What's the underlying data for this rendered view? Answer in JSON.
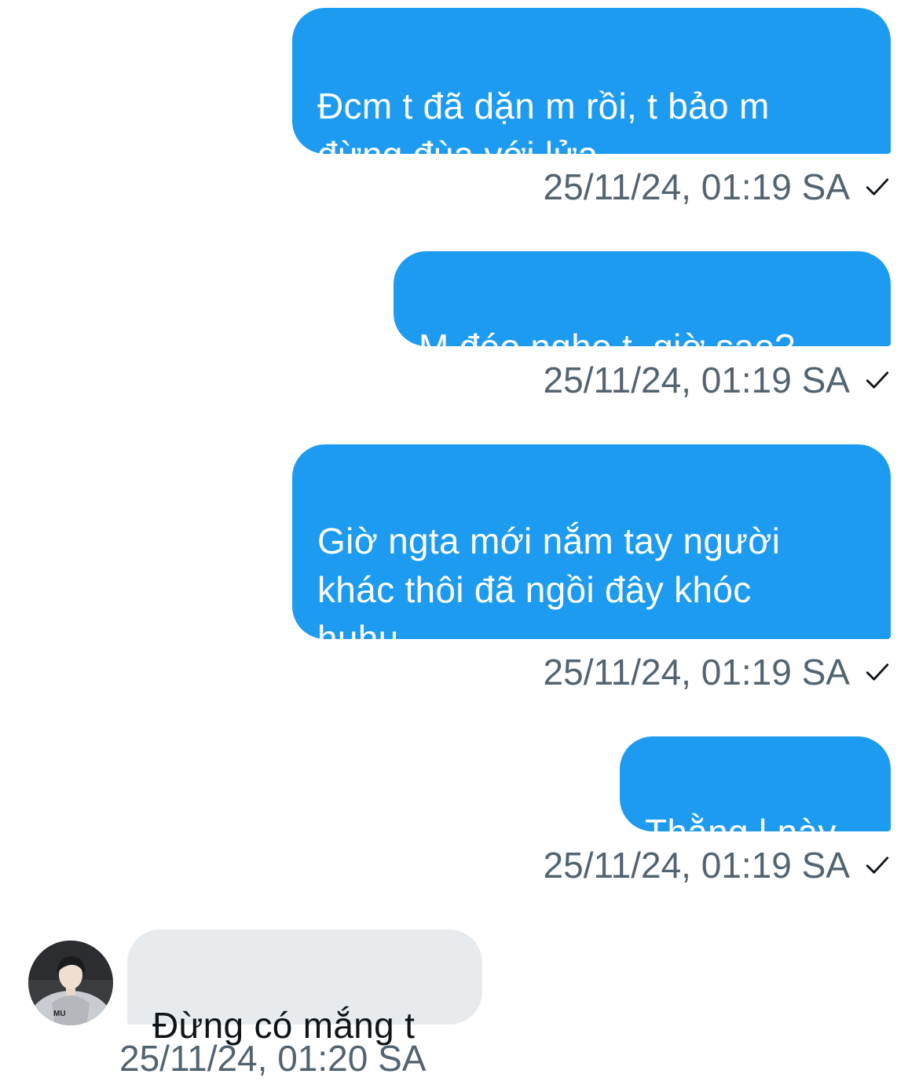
{
  "conversation": {
    "messages": [
      {
        "direction": "outgoing",
        "text": "Đcm t đã dặn m rồi, t bảo m\nđừng đùa với lửa",
        "timestamp": "25/11/24, 01:19 SA",
        "status_icon": "sent-check-icon"
      },
      {
        "direction": "outgoing",
        "text": "M đéo nghe t, giờ sao?",
        "timestamp": "25/11/24, 01:19 SA",
        "status_icon": "sent-check-icon"
      },
      {
        "direction": "outgoing",
        "text": "Giờ ngta mới nắm tay người\nkhác thôi đã ngồi đây khóc\nhuhu",
        "timestamp": "25/11/24, 01:19 SA",
        "status_icon": "sent-check-icon"
      },
      {
        "direction": "outgoing",
        "text": "Thằng l này",
        "timestamp": "25/11/24, 01:19 SA",
        "status_icon": "sent-check-icon"
      },
      {
        "direction": "incoming",
        "text": "Đừng có mắng t",
        "timestamp": "25/11/24, 01:20 SA",
        "sender_avatar": "avatar-icon"
      }
    ]
  },
  "colors": {
    "outgoing_bubble": "#1d9bf0",
    "incoming_bubble": "#e7ebee",
    "timestamp_text": "#536471"
  }
}
